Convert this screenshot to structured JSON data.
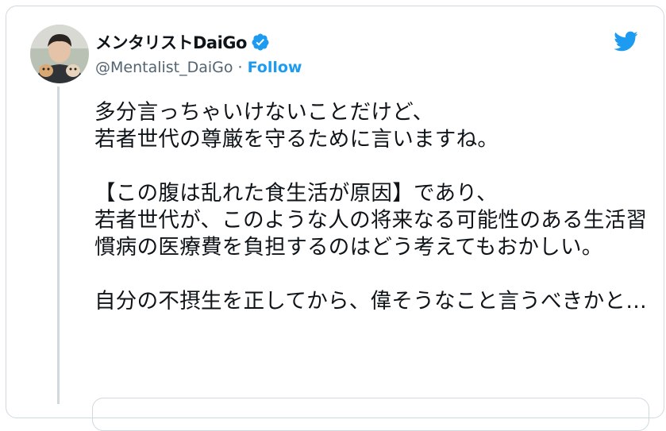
{
  "tweet": {
    "author_name": "メンタリストDaiGo",
    "author_handle": "@Mentalist_DaiGo",
    "separator": "·",
    "follow_label": "Follow",
    "text": "多分言っちゃいけないことだけど、\n若者世代の尊厳を守るために言いますね。\n\n【この腹は乱れた食生活が原因】であり、\n若者世代が、このような人の将来なる可能性のある生活習慣病の医療費を負担するのはどう考えてもおかしい。\n\n自分の不摂生を正してから、偉そうなこと言うべきかと…"
  },
  "colors": {
    "accent": "#1d9bf0",
    "text_primary": "#0f1419",
    "text_secondary": "#536471",
    "border": "#cfd9de"
  },
  "icons": {
    "verified": "verified-badge-icon",
    "brand": "twitter-bird-icon"
  }
}
